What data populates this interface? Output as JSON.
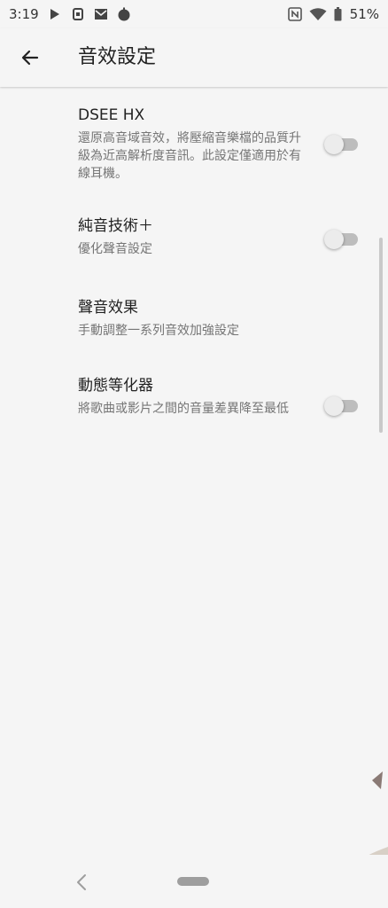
{
  "status_bar": {
    "time": "3:19",
    "battery": "51%",
    "icons_left": [
      "play-store-icon",
      "app-notification-icon",
      "mail-icon",
      "circle-app-icon"
    ],
    "icons_right": [
      "nfc-icon",
      "wifi-icon",
      "battery-icon"
    ]
  },
  "app_bar": {
    "back_icon": "arrow-left-icon",
    "title": "音效設定"
  },
  "settings": [
    {
      "title": "DSEE HX",
      "subtitle": "還原高音域音效，將壓縮音樂檔的品質升級為近高解析度音訊。此設定僅適用於有線耳機。",
      "has_toggle": true,
      "toggle_on": false
    },
    {
      "title": "純音技術＋",
      "subtitle": "優化聲音設定",
      "has_toggle": true,
      "toggle_on": false
    },
    {
      "title": "聲音效果",
      "subtitle": "手動調整一系列音效加強設定",
      "has_toggle": false
    },
    {
      "title": "動態等化器",
      "subtitle": "將歌曲或影片之間的音量差異降至最低",
      "has_toggle": true,
      "toggle_on": false
    }
  ],
  "nav_bar": {
    "back_icon": "nav-back-icon",
    "home_icon": "nav-home-pill-icon"
  },
  "colors": {
    "background": "#f5f5f5",
    "text_primary": "#222222",
    "text_secondary": "#757575",
    "toggle_track_off": "#bdbdbd",
    "toggle_thumb_off": "#ececec"
  }
}
